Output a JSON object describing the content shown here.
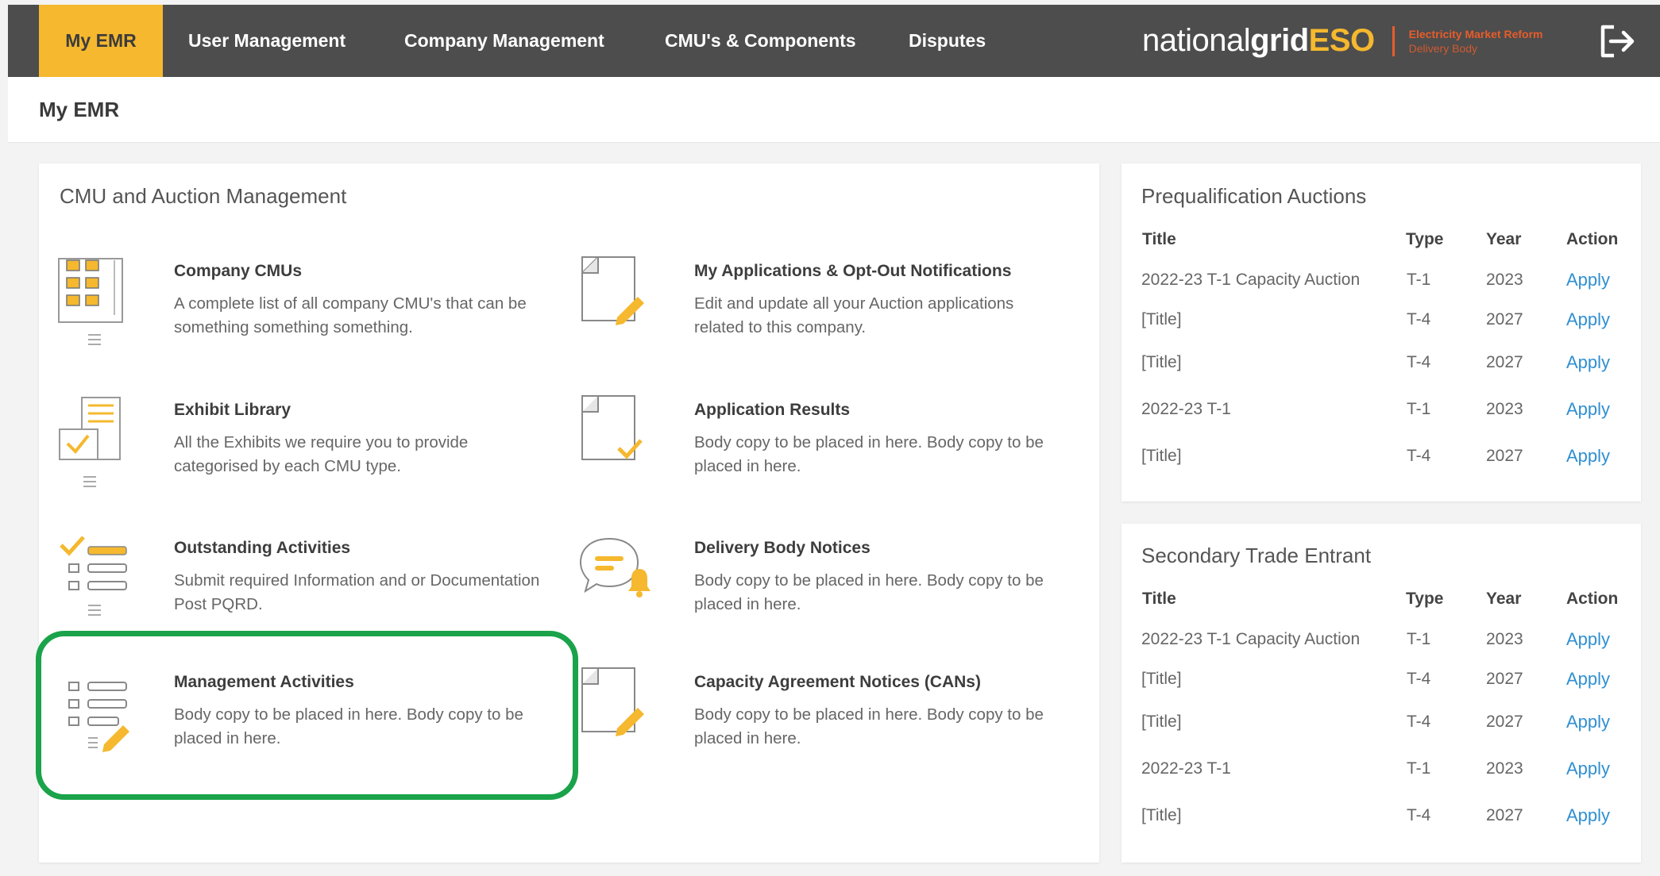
{
  "nav": {
    "items": [
      {
        "label": "My EMR"
      },
      {
        "label": "User Management"
      },
      {
        "label": "Company Management"
      },
      {
        "label": "CMU's & Components"
      },
      {
        "label": "Disputes"
      }
    ],
    "logo": {
      "part1": "national",
      "part2": "grid",
      "part3": "ESO",
      "sub1": "Electricity Market Reform",
      "sub2": "Delivery Body"
    },
    "logout_icon": "logout-icon"
  },
  "page": {
    "title": "My EMR"
  },
  "cmu_card": {
    "title": "CMU and Auction Management",
    "tiles": [
      {
        "title": "Company CMUs",
        "desc": "A complete list of all company CMU's that can be something something something.",
        "icon": "grid-list-icon"
      },
      {
        "title": "My Applications & Opt-Out Notifications",
        "desc": "Edit and update all your Auction applications related to this company.",
        "icon": "document-edit-icon"
      },
      {
        "title": "Exhibit Library",
        "desc": "All the Exhibits we require you to provide categorised by each CMU type.",
        "icon": "exhibit-library-icon"
      },
      {
        "title": "Application Results",
        "desc": "Body copy to be placed in here. Body copy to be placed in here.",
        "icon": "document-check-icon"
      },
      {
        "title": "Outstanding Activities",
        "desc": "Submit required Information and or Documentation Post PQRD.",
        "icon": "checklist-icon"
      },
      {
        "title": "Delivery Body Notices",
        "desc": "Body copy to be placed in here. Body copy to be placed in here.",
        "icon": "notice-chat-icon"
      },
      {
        "title": "Management Activities",
        "desc": "Body copy to be placed in here. Body copy to be placed in here.",
        "icon": "list-edit-icon"
      },
      {
        "title": "Capacity Agreement Notices (CANs)",
        "desc": "Body copy to be placed in here. Body copy to be placed in here.",
        "icon": "document-edit-icon"
      }
    ]
  },
  "prequal": {
    "title": "Prequalification Auctions",
    "headers": [
      "Title",
      "Type",
      "Year",
      "Action"
    ],
    "rows": [
      [
        "2022-23 T-1 Capacity Auction",
        "T-1",
        "2023",
        "Apply"
      ],
      [
        "[Title]",
        "T-4",
        "2027",
        "Apply"
      ],
      [
        "[Title]",
        "T-4",
        "2027",
        "Apply"
      ],
      [
        "2022-23 T-1",
        "T-1",
        "2023",
        "Apply"
      ],
      [
        "[Title]",
        "T-4",
        "2027",
        "Apply"
      ]
    ]
  },
  "secondary": {
    "title": "Secondary Trade Entrant",
    "headers": [
      "Title",
      "Type",
      "Year",
      "Action"
    ],
    "rows": [
      [
        "2022-23 T-1 Capacity Auction",
        "T-1",
        "2023",
        "Apply"
      ],
      [
        "[Title]",
        "T-4",
        "2027",
        "Apply"
      ],
      [
        "[Title]",
        "T-4",
        "2027",
        "Apply"
      ],
      [
        "2022-23 T-1",
        "T-1",
        "2023",
        "Apply"
      ],
      [
        "[Title]",
        "T-4",
        "2027",
        "Apply"
      ]
    ]
  },
  "colors": {
    "nav_bg": "#4d4d4d",
    "accent": "#f5b82e",
    "link": "#2f8fd1",
    "highlight": "#1aa34a",
    "brand_orange": "#e85c2a"
  }
}
